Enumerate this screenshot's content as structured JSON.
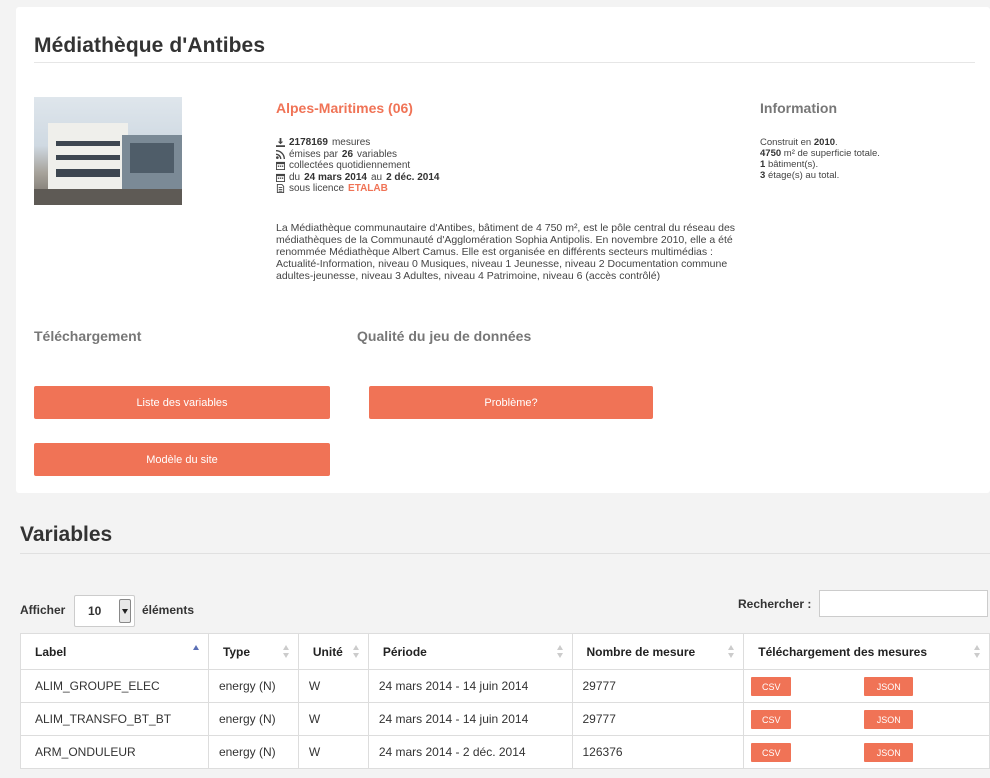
{
  "page": {
    "title": "Médiathèque d'Antibes",
    "region": "Alpes-Maritimes (06)",
    "stats": {
      "mesures_count": "2178169",
      "mesures_label": "mesures",
      "emises_prefix": "émises par",
      "variables_count": "26",
      "variables_label": "variables",
      "frequency": "collectées quotidiennement",
      "period_prefix": "du",
      "period_start": "24 mars 2014",
      "period_mid": "au",
      "period_end": "2 déc. 2014",
      "license_prefix": "sous licence",
      "license": "ETALAB"
    },
    "description": "La Médiathèque communautaire d'Antibes, bâtiment de 4 750 m², est le pôle central du réseau des médiathèques de la Communauté d'Agglomération Sophia Antipolis. En novembre 2010, elle a été renommée Médiathèque Albert Camus. Elle est organisée en différents secteurs multimédias : Actualité-Information, niveau 0 Musiques, niveau 1 Jeunesse, niveau 2 Documentation commune adultes-jeunesse, niveau 3 Adultes, niveau 4 Patrimoine, niveau 6 (accès contrôlé)",
    "information": {
      "title": "Information",
      "built_prefix": "Construit en",
      "built_year": "2010",
      "built_suffix": ".",
      "area": "4750",
      "area_suffix": "m² de superficie totale.",
      "buildings": "1",
      "buildings_suffix": "bâtiment(s).",
      "floors": "3",
      "floors_suffix": "étage(s) au total."
    },
    "sections": {
      "download_title": "Téléchargement",
      "quality_title": "Qualité du jeu de données"
    },
    "buttons": {
      "variables_list": "Liste des variables",
      "problem": "Problème?",
      "site_model": "Modèle du site"
    }
  },
  "variables": {
    "title": "Variables",
    "show_label": "Afficher",
    "show_value": "10",
    "elements_label": "éléments",
    "search_label": "Rechercher :",
    "search_value": "",
    "columns": [
      "Label",
      "Type",
      "Unité",
      "Période",
      "Nombre de mesure",
      "Téléchargement des mesures"
    ],
    "rows": [
      {
        "label": "ALIM_GROUPE_ELEC",
        "type": "energy (N)",
        "unit": "W",
        "period": "24 mars 2014 - 14 juin 2014",
        "count": "29777",
        "csv": "CSV",
        "json": "JSON"
      },
      {
        "label": "ALIM_TRANSFO_BT_BT",
        "type": "energy (N)",
        "unit": "W",
        "period": "24 mars 2014 - 14 juin 2014",
        "count": "29777",
        "csv": "CSV",
        "json": "JSON"
      },
      {
        "label": "ARM_ONDULEUR",
        "type": "energy (N)",
        "unit": "W",
        "period": "24 mars 2014 - 2 déc. 2014",
        "count": "126376",
        "csv": "CSV",
        "json": "JSON"
      }
    ]
  },
  "colors": {
    "accent": "#f07356",
    "background": "#f3f3f3"
  }
}
